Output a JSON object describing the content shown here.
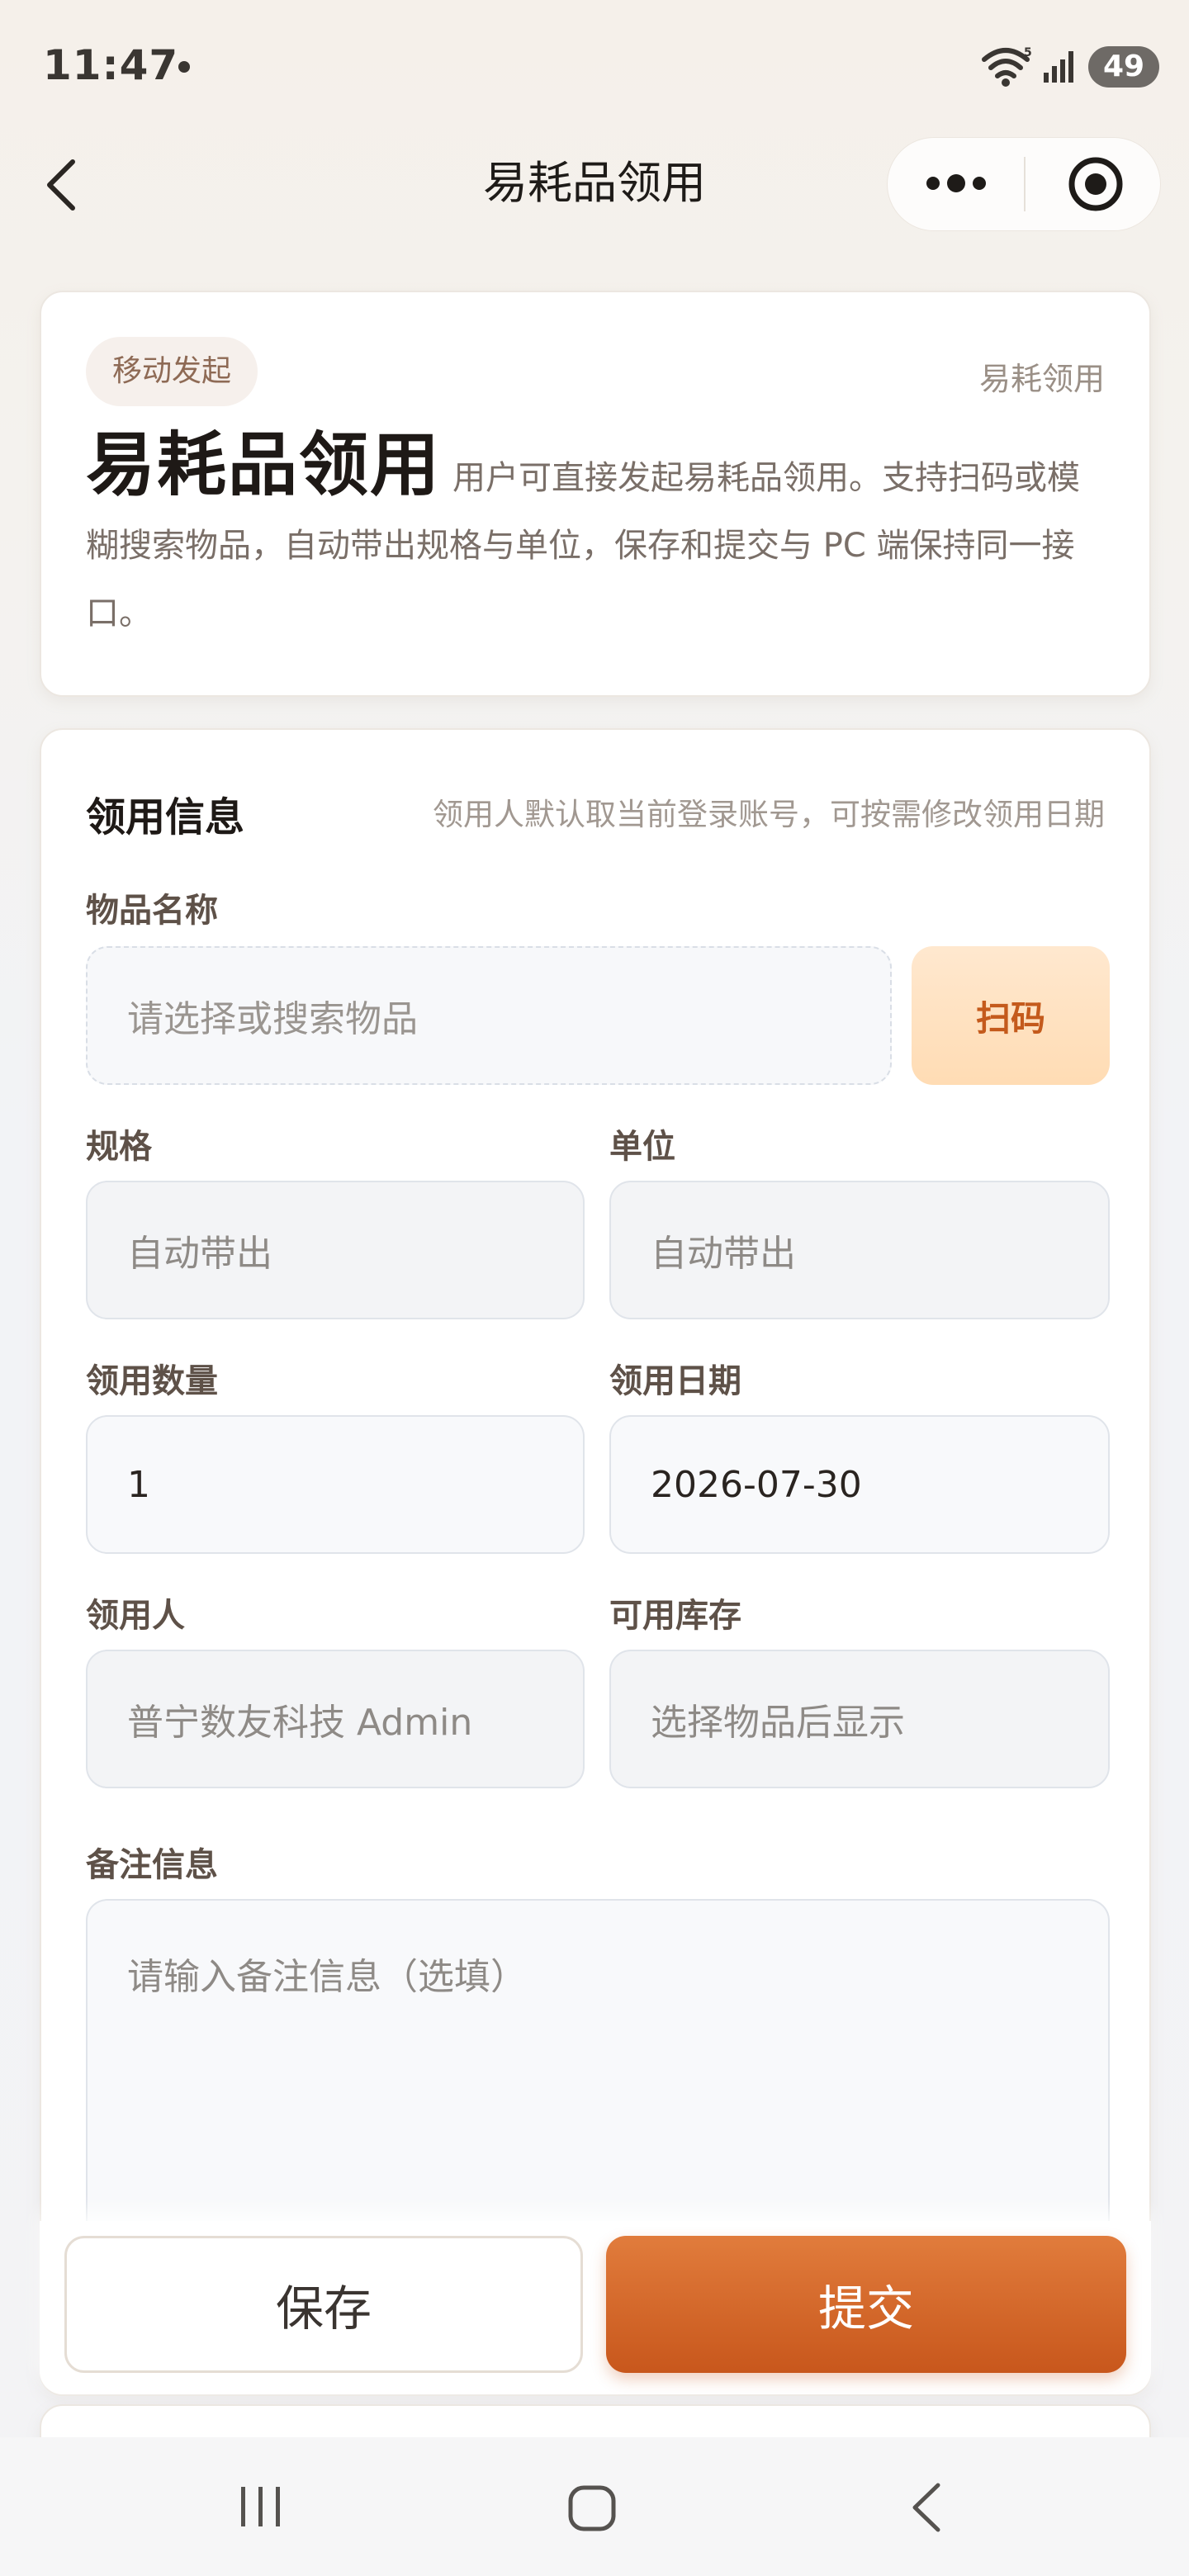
{
  "status": {
    "time": "11:47",
    "battery": "49",
    "wifi_icon": "wifi-icon",
    "signal_icon": "signal-icon"
  },
  "nav": {
    "title": "易耗品领用",
    "back_icon": "chevron-left-icon",
    "more_icon": "more-dots-icon",
    "close_icon": "target-close-icon"
  },
  "hero": {
    "tag": "移动发起",
    "type": "易耗领用",
    "title": "易耗品领用",
    "description": "用户可直接发起易耗品领用。支持扫码或模糊搜索物品，自动带出规格与单位，保存和提交与 PC 端保持同一接口。"
  },
  "form": {
    "section_title": "领用信息",
    "section_hint": "领用人默认取当前登录账号，可按需修改领用日期",
    "item_name": {
      "label": "物品名称",
      "placeholder": "请选择或搜索物品"
    },
    "scan_label": "扫码",
    "spec": {
      "label": "规格",
      "value": "自动带出"
    },
    "unit": {
      "label": "单位",
      "value": "自动带出"
    },
    "quantity": {
      "label": "领用数量",
      "value": "1"
    },
    "date": {
      "label": "领用日期",
      "value": "2026-07-30"
    },
    "receiver": {
      "label": "领用人",
      "value": "普宁数友科技 Admin"
    },
    "stock": {
      "label": "可用库存",
      "value": "选择物品后显示"
    },
    "remark": {
      "label": "备注信息",
      "placeholder": "请输入备注信息（选填）"
    }
  },
  "actions": {
    "save_label": "保存",
    "submit_label": "提交"
  },
  "colors": {
    "accent": "#d0662a",
    "accent_light": "#ffdfbc",
    "title": "#1e1916"
  }
}
